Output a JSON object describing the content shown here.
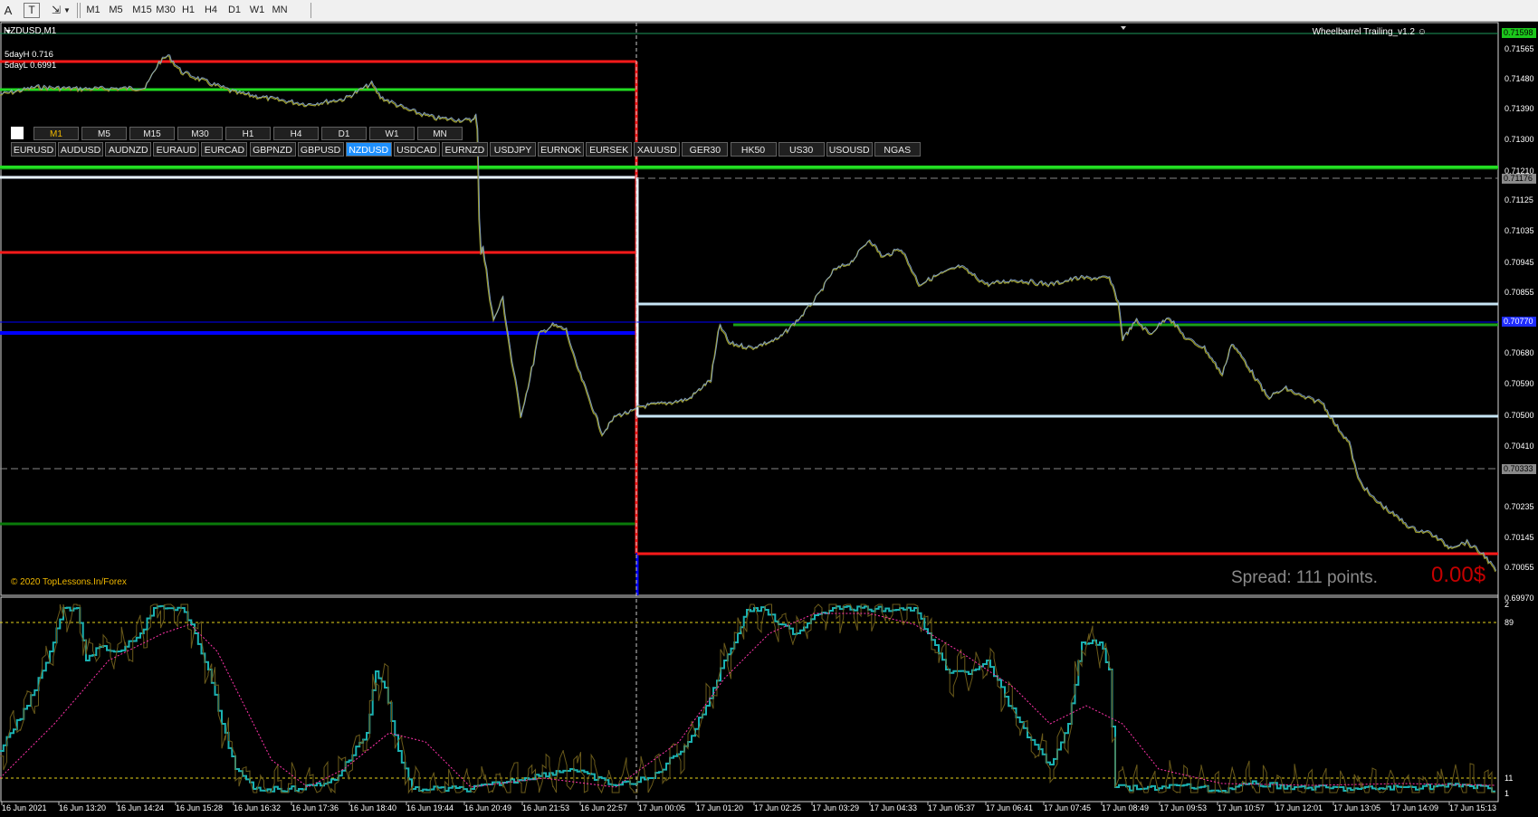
{
  "toolbar": {
    "tools": [
      {
        "name": "text-a-tool-icon",
        "glyph": "A"
      },
      {
        "name": "text-label-tool-icon",
        "glyph": "T"
      },
      {
        "name": "arrows-tool-icon",
        "glyph": "⇲"
      }
    ],
    "timeframes": [
      "M1",
      "M5",
      "M15",
      "M30",
      "H1",
      "H4",
      "D1",
      "W1",
      "MN"
    ]
  },
  "chart": {
    "symbol_title": "NZDUSD,M1",
    "ea_name": "Wheelbarrel Trailing_v1.2 ☺",
    "hud": {
      "fiveday_high": "5dayH 0.716",
      "fiveday_low": "5dayL 0.6991"
    },
    "copyright": "© 2020 TopLessons.In/Forex",
    "spread": "Spread: 111 points.",
    "profit": "0.00$",
    "tf_panel": {
      "buttons": [
        "M1",
        "M5",
        "M15",
        "M30",
        "H1",
        "H4",
        "D1",
        "W1",
        "MN"
      ],
      "active": "M1"
    },
    "symbol_panel": {
      "buttons": [
        "EURUSD",
        "AUDUSD",
        "AUDNZD",
        "EURAUD",
        "EURCAD",
        "GBPNZD",
        "GBPUSD",
        "NZDUSD",
        "USDCAD",
        "EURNZD",
        "USDJPY",
        "EURNOK",
        "EURSEK",
        "XAUUSD",
        "GER30",
        "HK50",
        "US30",
        "USOUSD",
        "NGAS"
      ],
      "active": "NZDUSD"
    },
    "price_scale": [
      "0.71598",
      "0.71565",
      "0.71480",
      "0.71390",
      "0.71300",
      "0.71210",
      "0.71176",
      "0.71125",
      "0.71035",
      "0.70945",
      "0.70855",
      "0.70770",
      "0.70680",
      "0.70590",
      "0.70500",
      "0.70410",
      "0.70333",
      "0.70235",
      "0.70145",
      "0.70055",
      "0.69970"
    ],
    "price_tags": {
      "current": "0.71598",
      "level_a": "0.71176",
      "level_b": "0.70333",
      "level_c": "0.70770"
    },
    "time_axis": [
      "16 Jun 2021",
      "16 Jun 13:20",
      "16 Jun 14:24",
      "16 Jun 15:28",
      "16 Jun 16:32",
      "16 Jun 17:36",
      "16 Jun 18:40",
      "16 Jun 19:44",
      "16 Jun 20:49",
      "16 Jun 21:53",
      "16 Jun 22:57",
      "17 Jun 00:05",
      "17 Jun 01:20",
      "17 Jun 02:25",
      "17 Jun 03:29",
      "17 Jun 04:33",
      "17 Jun 05:37",
      "17 Jun 06:41",
      "17 Jun 07:45",
      "17 Jun 08:49",
      "17 Jun 09:53",
      "17 Jun 10:57",
      "17 Jun 12:01",
      "17 Jun 13:05",
      "17 Jun 14:09",
      "17 Jun 15:13"
    ],
    "indicator_scale": [
      "2",
      "89",
      "11",
      "1"
    ],
    "colors": {
      "bull": "#87a8d8",
      "bear": "#9a9a2a",
      "red": "#ff1a1a",
      "green": "#22dd22",
      "darkgreen": "#0a7a0a",
      "blue": "#0000ff",
      "ice": "#c8e6f5",
      "teal": "#1ab2b2",
      "magenta": "#ff33aa"
    }
  }
}
